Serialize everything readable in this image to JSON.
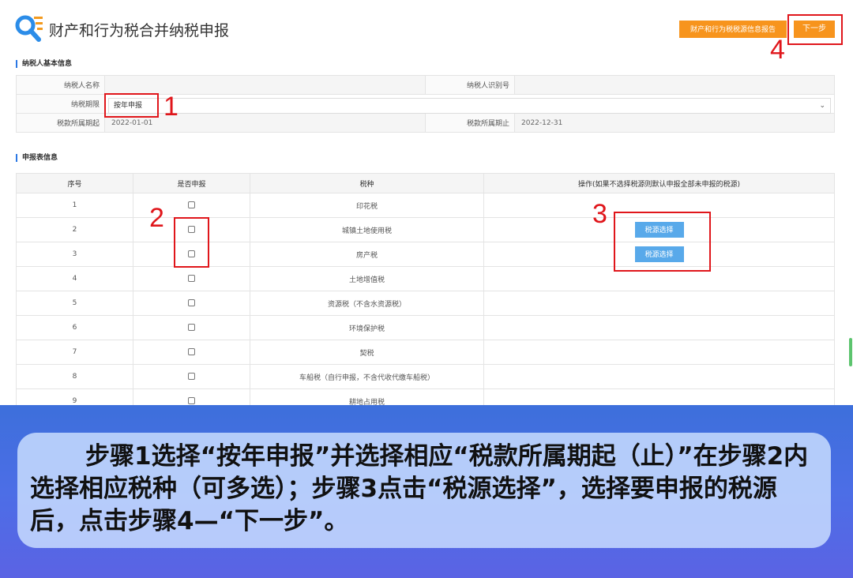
{
  "header": {
    "title": "财产和行为税合并纳税申报",
    "report_button": "财产和行为税税源信息报告",
    "next_button": "下一步"
  },
  "taxpayer": {
    "section_title": "纳税人基本信息",
    "name_label": "纳税人名称",
    "name_value": "",
    "id_label": "纳税人识别号",
    "id_value": "",
    "period_label": "纳税期限",
    "period_value": "按年申报",
    "start_label": "税款所属期起",
    "start_value": "2022-01-01",
    "end_label": "税款所属期止",
    "end_value": "2022-12-31"
  },
  "declaration": {
    "section_title": "申报表信息",
    "headers": [
      "序号",
      "是否申报",
      "税种",
      "操作(如果不选择税源则默认申报全部未申报的税源)"
    ],
    "rows": [
      {
        "no": "1",
        "tax": "印花税",
        "action": ""
      },
      {
        "no": "2",
        "tax": "城镇土地使用税",
        "action": "税源选择"
      },
      {
        "no": "3",
        "tax": "房产税",
        "action": "税源选择"
      },
      {
        "no": "4",
        "tax": "土地增值税",
        "action": ""
      },
      {
        "no": "5",
        "tax": "资源税（不含水资源税）",
        "action": ""
      },
      {
        "no": "6",
        "tax": "环境保护税",
        "action": ""
      },
      {
        "no": "7",
        "tax": "契税",
        "action": ""
      },
      {
        "no": "8",
        "tax": "车船税（自行申报，不含代收代缴车船税）",
        "action": ""
      },
      {
        "no": "9",
        "tax": "耕地占用税",
        "action": ""
      }
    ]
  },
  "annotations": {
    "step1": "1",
    "step2": "2",
    "step3": "3",
    "step4": "4"
  },
  "caption": "步骤1选择“按年申报”并选择相应“税款所属期起（止）”在步骤2内选择相应税种（可多选）；步骤3点击“税源选择”，选择要申报的税源后，点击步骤4—“下一步”。",
  "colors": {
    "accent_orange": "#f7941d",
    "button_blue": "#58a9ea",
    "annotation_red": "#e0161b"
  }
}
